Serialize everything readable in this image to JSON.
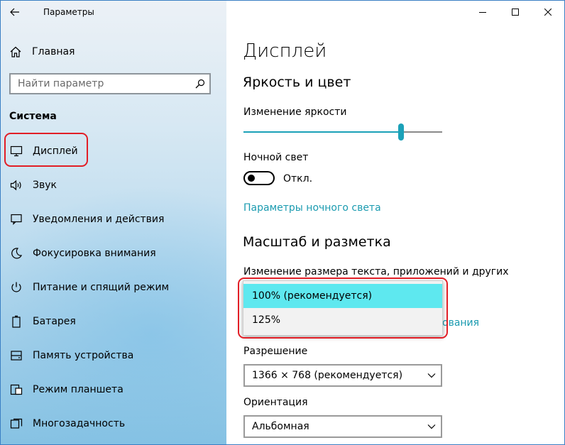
{
  "window": {
    "title": "Параметры"
  },
  "sidebar": {
    "home_label": "Главная",
    "search_placeholder": "Найти параметр",
    "section_title": "Система",
    "items": [
      {
        "label": "Дисплей",
        "icon": "monitor-icon"
      },
      {
        "label": "Звук",
        "icon": "speaker-icon"
      },
      {
        "label": "Уведомления и действия",
        "icon": "notification-icon"
      },
      {
        "label": "Фокусировка внимания",
        "icon": "moon-icon"
      },
      {
        "label": "Питание и спящий режим",
        "icon": "power-icon"
      },
      {
        "label": "Батарея",
        "icon": "battery-icon"
      },
      {
        "label": "Память устройства",
        "icon": "storage-icon"
      },
      {
        "label": "Режим планшета",
        "icon": "tablet-mode-icon"
      },
      {
        "label": "Многозадачность",
        "icon": "multitasking-icon"
      }
    ]
  },
  "content": {
    "page_title": "Дисплей",
    "brightness_section": "Яркость и цвет",
    "brightness_label": "Изменение яркости",
    "brightness_value_fraction": 0.8,
    "night_light_label": "Ночной свет",
    "night_light_state": "Откл.",
    "night_light_link": "Параметры ночного света",
    "scale_section": "Масштаб и разметка",
    "scale_label": "Изменение размера текста, приложений и других элементов",
    "scale_options": [
      "100% (рекомендуется)",
      "125%"
    ],
    "hidden_link_fragment": "ования",
    "resolution_label": "Разрешение",
    "resolution_value": "1366 × 768 (рекомендуется)",
    "orientation_label": "Ориентация",
    "orientation_value": "Альбомная"
  },
  "colors": {
    "accent": "#1ba1b8",
    "selected_option": "#5ee8ef",
    "highlight_frame": "#e21e26"
  }
}
